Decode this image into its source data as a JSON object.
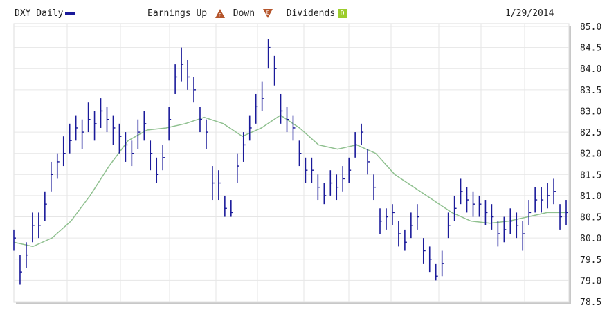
{
  "header": {
    "symbol_label": "DXY Daily",
    "earnings_label": "Earnings Up",
    "down_label": "Down",
    "dividends_label": "Dividends",
    "earnings_icon_letter": "E",
    "dividend_icon_letter": "D",
    "date": "1/29/2014"
  },
  "colors": {
    "price": "#1a1a9a",
    "ma": "#8fc08f",
    "earnings": "#b5552b",
    "dividend": "#9ccc2c",
    "grid": "#e6e6e6"
  },
  "chart_data": {
    "type": "ohlc",
    "title": "DXY Daily",
    "ylim": [
      78.5,
      85.0
    ],
    "yticks": [
      "85.0",
      "84.5",
      "84.0",
      "83.5",
      "83.0",
      "82.5",
      "82.0",
      "81.5",
      "81.0",
      "80.5",
      "80.0",
      "79.5",
      "79.0",
      "78.5"
    ],
    "grid": true,
    "series": [
      {
        "name": "DXY Daily",
        "bars_low_high_close": [
          [
            79.7,
            80.2,
            80.0
          ],
          [
            78.9,
            79.6,
            79.2
          ],
          [
            79.3,
            79.9,
            79.6
          ],
          [
            79.9,
            80.6,
            80.3
          ],
          [
            80.0,
            80.6,
            80.3
          ],
          [
            80.4,
            81.1,
            80.8
          ],
          [
            81.1,
            81.8,
            81.5
          ],
          [
            81.4,
            82.0,
            81.8
          ],
          [
            81.7,
            82.4,
            82.0
          ],
          [
            82.0,
            82.7,
            82.3
          ],
          [
            82.3,
            82.9,
            82.6
          ],
          [
            82.1,
            82.8,
            82.5
          ],
          [
            82.5,
            83.2,
            82.8
          ],
          [
            82.3,
            83.0,
            82.7
          ],
          [
            82.6,
            83.3,
            83.0
          ],
          [
            82.5,
            83.1,
            82.8
          ],
          [
            82.2,
            82.9,
            82.6
          ],
          [
            82.0,
            82.7,
            82.4
          ],
          [
            81.8,
            82.5,
            82.2
          ],
          [
            81.7,
            82.3,
            82.0
          ],
          [
            82.1,
            82.8,
            82.5
          ],
          [
            82.3,
            83.0,
            82.7
          ],
          [
            81.6,
            82.3,
            82.0
          ],
          [
            81.3,
            81.9,
            81.5
          ],
          [
            81.6,
            82.2,
            81.9
          ],
          [
            82.3,
            83.1,
            82.8
          ],
          [
            83.4,
            84.1,
            83.8
          ],
          [
            83.7,
            84.5,
            84.1
          ],
          [
            83.5,
            84.2,
            83.8
          ],
          [
            83.2,
            83.8,
            83.5
          ],
          [
            82.5,
            83.1,
            82.8
          ],
          [
            82.1,
            82.8,
            82.5
          ],
          [
            80.9,
            81.7,
            81.3
          ],
          [
            80.9,
            81.6,
            81.3
          ],
          [
            80.5,
            81.0,
            80.7
          ],
          [
            80.5,
            80.9,
            80.6
          ],
          [
            81.3,
            82.0,
            81.7
          ],
          [
            81.8,
            82.5,
            82.2
          ],
          [
            82.3,
            82.9,
            82.6
          ],
          [
            82.7,
            83.4,
            83.1
          ],
          [
            83.0,
            83.7,
            83.3
          ],
          [
            84.0,
            84.7,
            84.5
          ],
          [
            83.6,
            84.3,
            84.0
          ],
          [
            82.7,
            83.4,
            83.0
          ],
          [
            82.5,
            83.1,
            82.8
          ],
          [
            82.3,
            82.9,
            82.6
          ],
          [
            81.7,
            82.3,
            82.0
          ],
          [
            81.3,
            81.9,
            81.6
          ],
          [
            81.3,
            81.9,
            81.6
          ],
          [
            80.9,
            81.5,
            81.2
          ],
          [
            80.8,
            81.3,
            81.0
          ],
          [
            81.0,
            81.6,
            81.3
          ],
          [
            80.9,
            81.5,
            81.2
          ],
          [
            81.1,
            81.7,
            81.4
          ],
          [
            81.3,
            81.9,
            81.6
          ],
          [
            81.9,
            82.5,
            82.2
          ],
          [
            82.2,
            82.7,
            82.5
          ],
          [
            81.5,
            82.1,
            81.8
          ],
          [
            80.9,
            81.5,
            81.2
          ],
          [
            80.1,
            80.7,
            80.4
          ],
          [
            80.2,
            80.7,
            80.5
          ],
          [
            80.3,
            80.8,
            80.6
          ],
          [
            79.8,
            80.4,
            80.1
          ],
          [
            79.7,
            80.2,
            79.9
          ],
          [
            80.0,
            80.6,
            80.3
          ],
          [
            80.2,
            80.8,
            80.5
          ],
          [
            79.4,
            80.0,
            79.7
          ],
          [
            79.2,
            79.8,
            79.5
          ],
          [
            79.0,
            79.4,
            79.1
          ],
          [
            79.1,
            79.7,
            79.4
          ],
          [
            80.0,
            80.6,
            80.3
          ],
          [
            80.4,
            81.0,
            80.7
          ],
          [
            80.8,
            81.4,
            81.1
          ],
          [
            80.6,
            81.2,
            80.9
          ],
          [
            80.5,
            81.1,
            80.8
          ],
          [
            80.5,
            81.0,
            80.8
          ],
          [
            80.3,
            80.9,
            80.6
          ],
          [
            80.2,
            80.8,
            80.5
          ],
          [
            79.8,
            80.4,
            80.1
          ],
          [
            79.9,
            80.5,
            80.2
          ],
          [
            80.1,
            80.7,
            80.4
          ],
          [
            80.0,
            80.6,
            80.3
          ],
          [
            79.7,
            80.4,
            80.1
          ],
          [
            80.3,
            80.9,
            80.6
          ],
          [
            80.6,
            81.2,
            80.9
          ],
          [
            80.6,
            81.2,
            80.9
          ],
          [
            80.7,
            81.3,
            81.0
          ],
          [
            80.8,
            81.4,
            81.1
          ],
          [
            80.2,
            80.8,
            80.5
          ],
          [
            80.3,
            80.9,
            80.6
          ]
        ]
      },
      {
        "name": "Moving Average",
        "values": [
          79.9,
          79.8,
          80.0,
          80.4,
          81.0,
          81.7,
          82.3,
          82.55,
          82.6,
          82.7,
          82.85,
          82.7,
          82.4,
          82.6,
          82.9,
          82.6,
          82.2,
          82.1,
          82.2,
          82.0,
          81.5,
          81.2,
          80.9,
          80.6,
          80.4,
          80.35,
          80.4,
          80.5,
          80.6,
          80.6
        ]
      }
    ]
  }
}
